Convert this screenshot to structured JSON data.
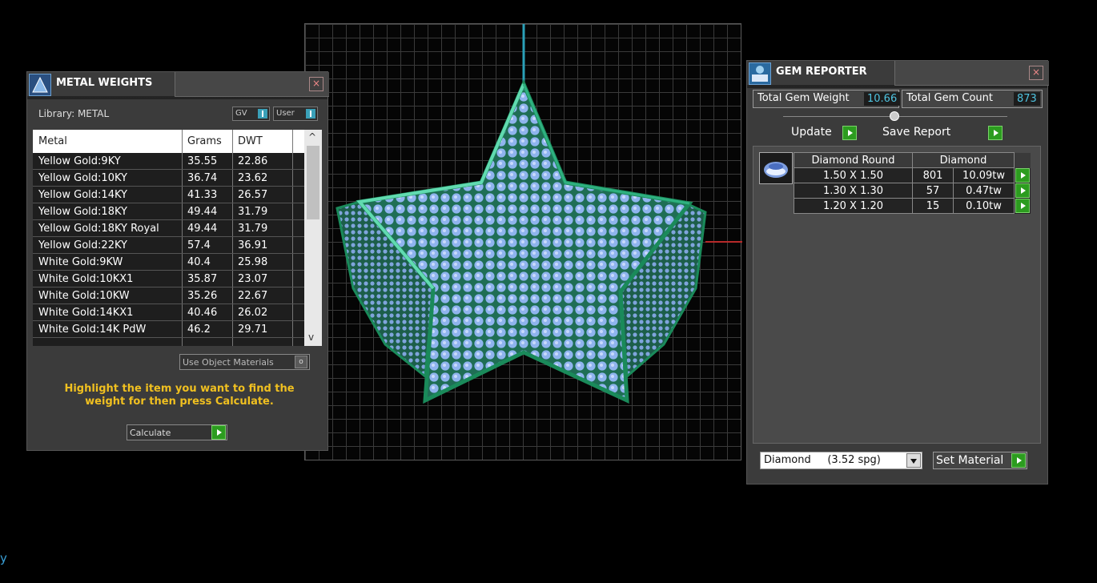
{
  "metal_weights": {
    "title": "METAL WEIGHTS",
    "library_label": "Library: METAL",
    "toggles": [
      "GV",
      "User"
    ],
    "columns": [
      "Metal",
      "Grams",
      "DWT"
    ],
    "rows": [
      {
        "metal": "Yellow Gold:9KY",
        "grams": "35.55",
        "dwt": "22.86"
      },
      {
        "metal": "Yellow Gold:10KY",
        "grams": "36.74",
        "dwt": "23.62"
      },
      {
        "metal": "Yellow Gold:14KY",
        "grams": "41.33",
        "dwt": "26.57"
      },
      {
        "metal": "Yellow Gold:18KY",
        "grams": "49.44",
        "dwt": "31.79"
      },
      {
        "metal": "Yellow Gold:18KY Royal",
        "grams": "49.44",
        "dwt": "31.79"
      },
      {
        "metal": "Yellow Gold:22KY",
        "grams": "57.4",
        "dwt": "36.91"
      },
      {
        "metal": "White Gold:9KW",
        "grams": "40.4",
        "dwt": "25.98"
      },
      {
        "metal": "White Gold:10KX1",
        "grams": "35.87",
        "dwt": "23.07"
      },
      {
        "metal": "White Gold:10KW",
        "grams": "35.26",
        "dwt": "22.67"
      },
      {
        "metal": "White Gold:14KX1",
        "grams": "40.46",
        "dwt": "26.02"
      },
      {
        "metal": "White Gold:14K PdW",
        "grams": "46.2",
        "dwt": "29.71"
      }
    ],
    "use_object_materials": "Use Object Materials",
    "hint": "Highlight the item you want to find the weight for then press Calculate.",
    "calculate": "Calculate"
  },
  "gem_reporter": {
    "title": "GEM REPORTER",
    "total_weight_label": "Total Gem Weight",
    "total_weight_value": "10.66",
    "total_count_label": "Total Gem Count",
    "total_count_value": "873",
    "update": "Update",
    "save_report": "Save Report",
    "shape": "Diamond Round",
    "material": "Diamond",
    "rows": [
      {
        "size": "1.50 X 1.50",
        "count": "801",
        "weight": "10.09tw"
      },
      {
        "size": "1.30 X 1.30",
        "count": "57",
        "weight": "0.47tw"
      },
      {
        "size": "1.20 X 1.20",
        "count": "15",
        "weight": "0.10tw"
      }
    ],
    "material_select": "Diamond     (3.52 spg)",
    "set_material": "Set Material"
  },
  "corner_text": "y",
  "colors": {
    "accent": "#4fc3e0",
    "hint": "#f0c020",
    "go": "#2c9c1f"
  }
}
